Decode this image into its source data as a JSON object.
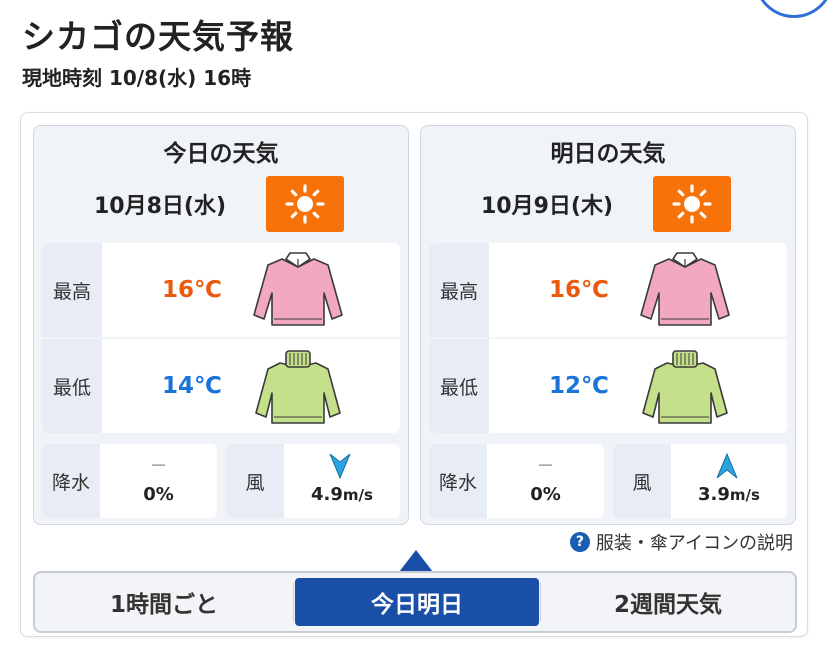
{
  "header": {
    "title": "シカゴの天気予報",
    "local_time": "現地時刻 10/8(水) 16時"
  },
  "days": [
    {
      "heading": "今日の天気",
      "date": "10月8日(水)",
      "weather_icon": "sunny-icon",
      "high_label": "最高",
      "high_temp": "16℃",
      "high_clothing_icon": "sweater-icon",
      "low_label": "最低",
      "low_temp": "14℃",
      "low_clothing_icon": "turtleneck-icon",
      "rain_label": "降水",
      "rain_dash": "－",
      "rain_value": "0%",
      "wind_label": "風",
      "wind_speed": "4.9",
      "wind_unit": "m/s",
      "wind_arrow_icon": "wind-arrow-icon"
    },
    {
      "heading": "明日の天気",
      "date": "10月9日(木)",
      "weather_icon": "sunny-icon",
      "high_label": "最高",
      "high_temp": "16℃",
      "high_clothing_icon": "sweater-icon",
      "low_label": "最低",
      "low_temp": "12℃",
      "low_clothing_icon": "turtleneck-icon",
      "rain_label": "降水",
      "rain_dash": "－",
      "rain_value": "0%",
      "wind_label": "風",
      "wind_speed": "3.9",
      "wind_unit": "m/s",
      "wind_arrow_icon": "wind-arrow-icon"
    }
  ],
  "help": {
    "icon": "question-icon",
    "icon_glyph": "?",
    "label": "服装・傘アイコンの説明"
  },
  "tabs": [
    {
      "label": "1時間ごと",
      "selected": false
    },
    {
      "label": "今日明日",
      "selected": true
    },
    {
      "label": "2週間天気",
      "selected": false
    }
  ],
  "colors": {
    "accent": "#1a4fa8",
    "sun_box": "#f7730a",
    "high_temp": "#ea5a0c",
    "low_temp": "#1a73d9",
    "sweater": "#f2a7c3",
    "turtleneck": "#c5e08a",
    "wind_arrow": "#2aa5e0"
  }
}
